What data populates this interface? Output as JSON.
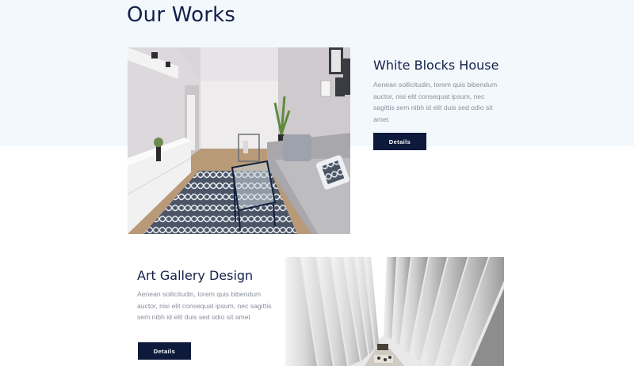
{
  "section": {
    "title": "Our Works"
  },
  "projects": [
    {
      "title": "White Blocks House",
      "description": "Aenean sollicitudin, lorem quis bibendum auctor, nisi elit consequat ipsum, nec sagittis sem nibh id elit duis sed odio sit amet",
      "button_label": "Details",
      "image_icon": "living-room-photo"
    },
    {
      "title": "Art Gallery Design",
      "description": "Aenean sollicitudin, lorem quis bibendum auctor, nisi elit consequat ipsum, nec sagittis sem nibh id elit duis sed odio sit amet",
      "button_label": "Details",
      "image_icon": "gallery-architecture-photo"
    }
  ],
  "colors": {
    "band": "#f3f8fd",
    "heading": "#13204a",
    "body_text": "#8a8f9c",
    "button": "#0d1a3b"
  }
}
